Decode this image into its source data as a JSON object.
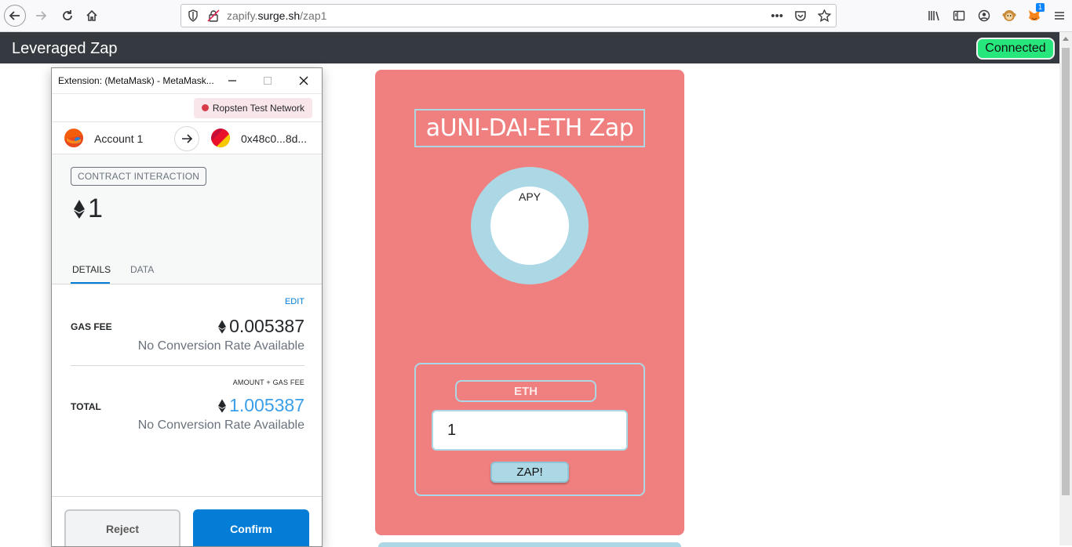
{
  "browser": {
    "url_prefix": "zapify.",
    "url_domain": "surge.sh",
    "url_path": "/zap1",
    "menu_icon": "hamburger-menu-icon",
    "extension_badge": "1"
  },
  "app": {
    "title": "Leveraged Zap",
    "connected_label": "Connected"
  },
  "zap": {
    "title": "aUNI-DAI-ETH Zap",
    "apy_label": "APY",
    "currency_label": "ETH",
    "amount_value": "1",
    "zap_button": "ZAP!"
  },
  "metamask": {
    "window_title": "Extension: (MetaMask) - MetaMask...",
    "network": "Ropsten Test Network",
    "from_account": "Account 1",
    "to_address": "0x48c0...8d...",
    "interaction_label": "CONTRACT INTERACTION",
    "amount": "1",
    "tabs": [
      "DETAILS",
      "DATA"
    ],
    "edit_label": "EDIT",
    "gas_fee_label": "GAS FEE",
    "gas_fee_value": "0.005387",
    "gas_fee_sub": "No Conversion Rate Available",
    "amount_gas_label": "AMOUNT + GAS FEE",
    "total_label": "TOTAL",
    "total_value": "1.005387",
    "total_sub": "No Conversion Rate Available",
    "reject_label": "Reject",
    "confirm_label": "Confirm"
  },
  "colors": {
    "card": "#f07f7f",
    "accent": "#acd8e6",
    "connected": "#27e67b",
    "metamask_blue": "#037dd6"
  }
}
